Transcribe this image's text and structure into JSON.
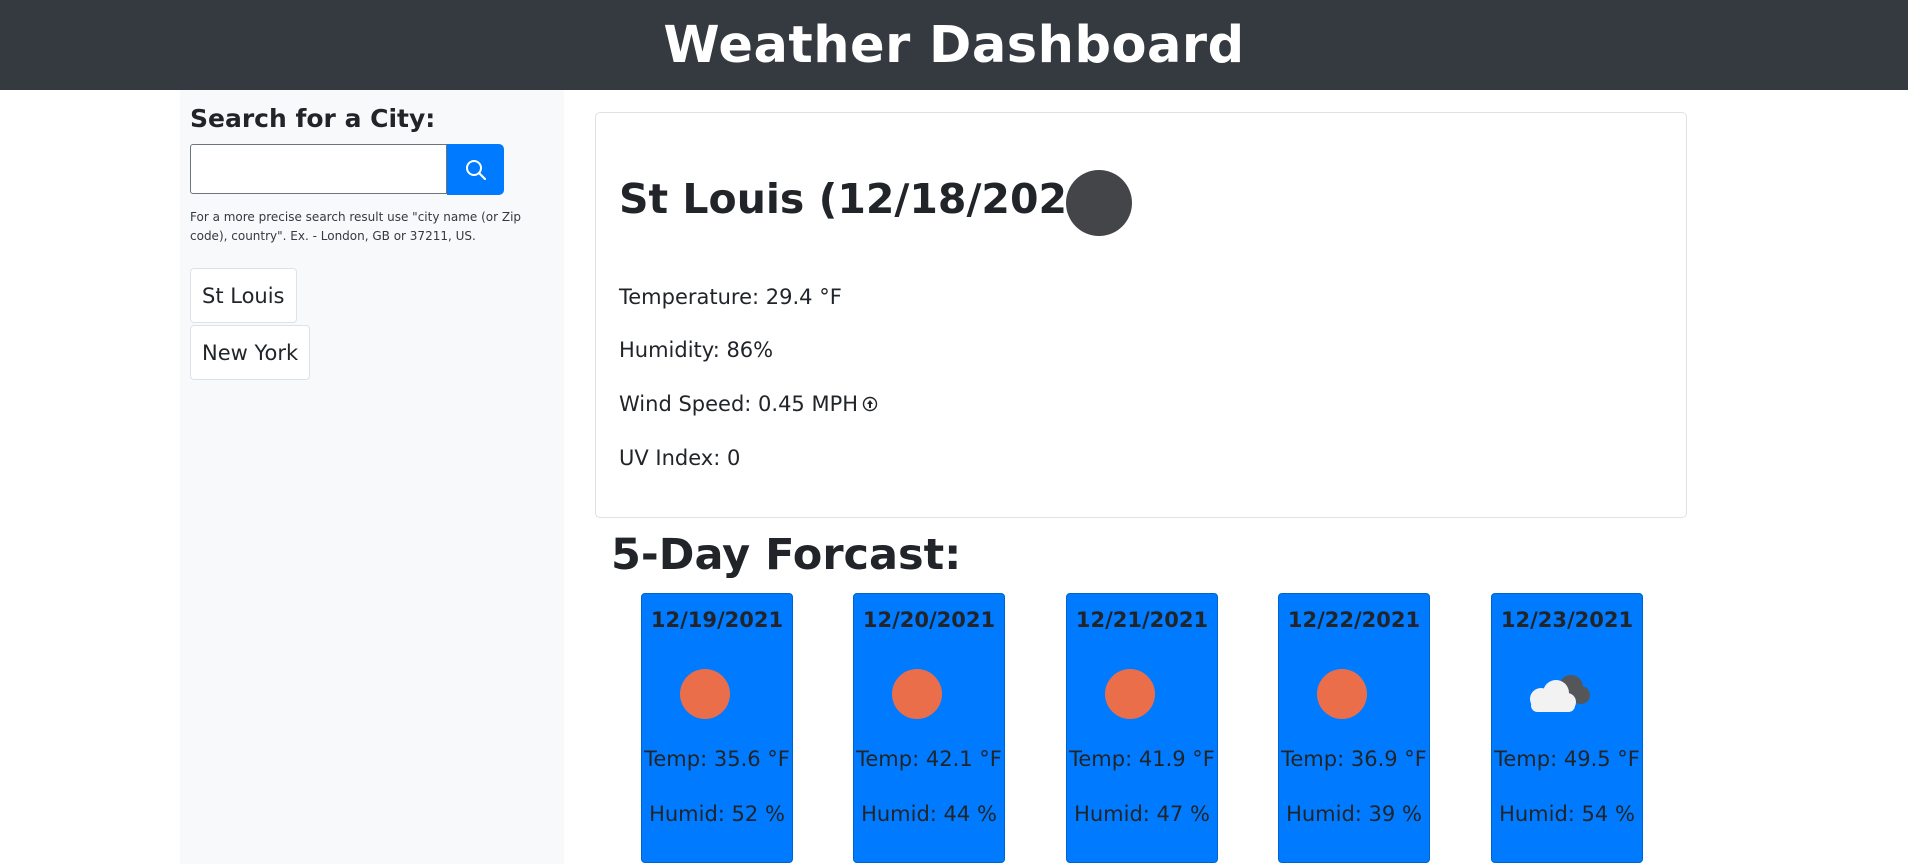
{
  "header": {
    "title": "Weather Dashboard"
  },
  "sidebar": {
    "search_label": "Search for a City:",
    "search_input_value": "",
    "search_hint": "For a more precise search result use \"city name (or Zip code), country\". Ex. - London, GB or 37211, US.",
    "history": [
      {
        "label": "St Louis"
      },
      {
        "label": "New York"
      }
    ]
  },
  "current": {
    "title": "St Louis (12/18/2021)",
    "icon": "night-clear-icon",
    "temperature": "Temperature: 29.4 °F",
    "humidity": "Humidity: 86%",
    "wind": "Wind Speed: 0.45 MPH",
    "uv": "UV Index: 0"
  },
  "forecast": {
    "title": "5-Day Forcast:",
    "days": [
      {
        "date": "12/19/2021",
        "icon": "sun-icon",
        "temp": "Temp: 35.6 °F",
        "humid": "Humid: 52 %"
      },
      {
        "date": "12/20/2021",
        "icon": "sun-icon",
        "temp": "Temp: 42.1 °F",
        "humid": "Humid: 44 %"
      },
      {
        "date": "12/21/2021",
        "icon": "sun-icon",
        "temp": "Temp: 41.9 °F",
        "humid": "Humid: 47 %"
      },
      {
        "date": "12/22/2021",
        "icon": "sun-icon",
        "temp": "Temp: 36.9 °F",
        "humid": "Humid: 39 %"
      },
      {
        "date": "12/23/2021",
        "icon": "cloud-icon",
        "temp": "Temp: 49.5 °F",
        "humid": "Humid: 54 %"
      }
    ]
  },
  "colors": {
    "header_bg": "#343a40",
    "accent": "#007bff",
    "sun": "#eb6e4b"
  }
}
